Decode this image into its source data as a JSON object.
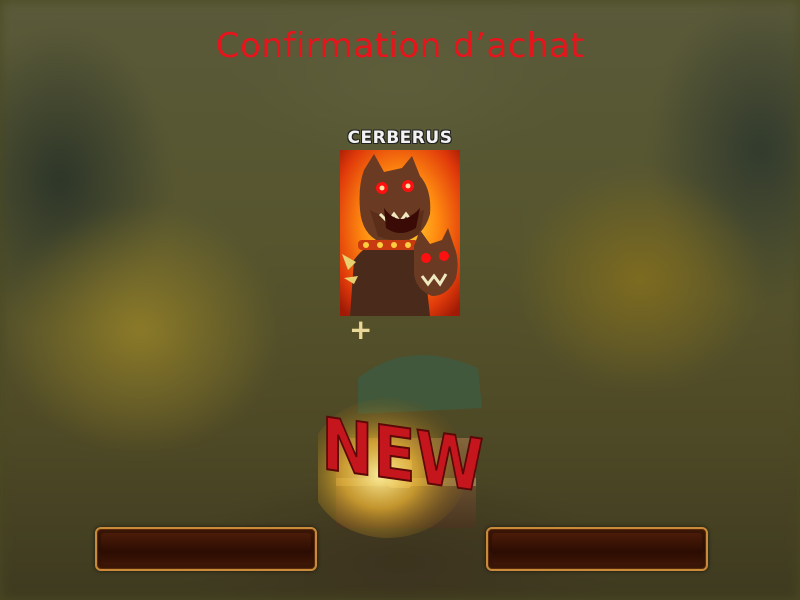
{
  "screen": {
    "title": "Confirmation d’achat"
  },
  "offer": {
    "card_name": "CERBERUS",
    "card_icon": "cerberus-portrait",
    "plus_symbol": "+",
    "bonus_label": "NEW",
    "bonus_icon": "treasure-chest"
  },
  "buttons": {
    "left_label": "",
    "right_label": ""
  },
  "colors": {
    "title": "#e8141c",
    "new_label": "#c4161c",
    "button_border": "#c98a3a"
  }
}
